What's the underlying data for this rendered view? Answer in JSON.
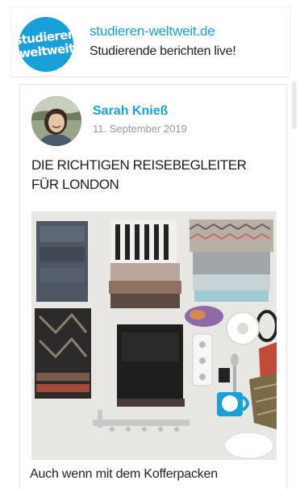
{
  "header": {
    "logo_line1": "studieren",
    "logo_line2": "weltweit",
    "site_name": "studieren-weltweit.de",
    "tagline": "Studierende berichten live!",
    "brand_color": "#1a9fd9"
  },
  "post": {
    "author": "Sarah Knieß",
    "date": "11. September 2019",
    "title": "DIE RICHTIGEN REISEBEGLEITER FÜR LONDON",
    "excerpt": "Auch wenn mit dem Kofferpacken",
    "image_icon": "packing-photo",
    "mug_text": "studieren weltweit"
  }
}
